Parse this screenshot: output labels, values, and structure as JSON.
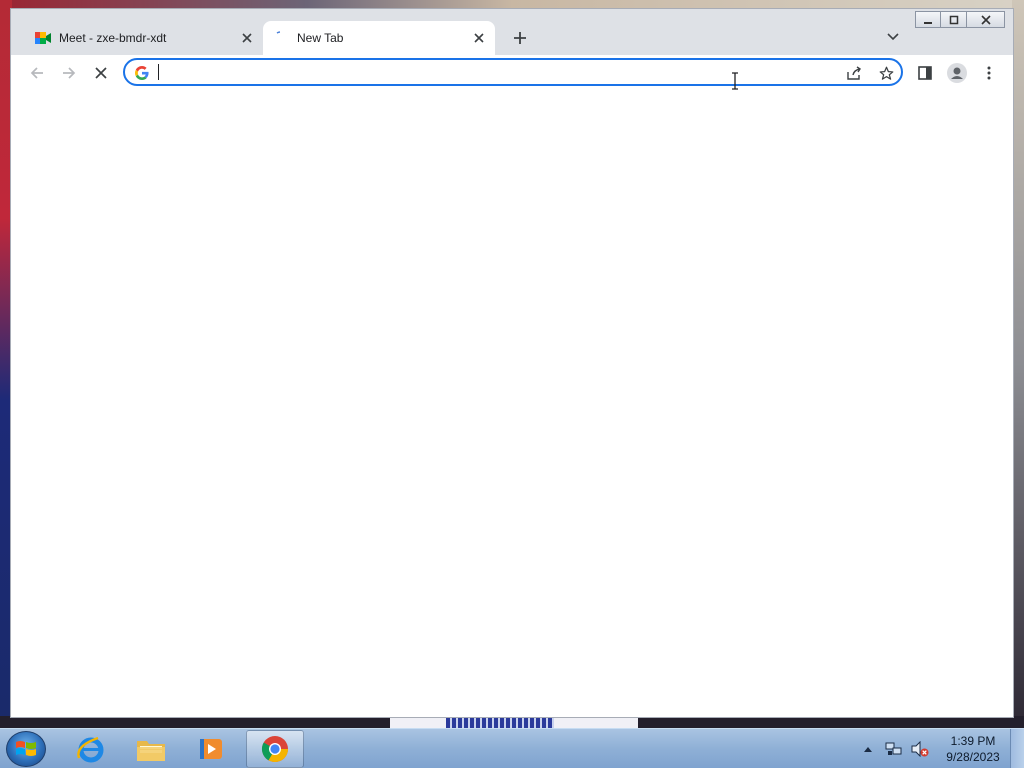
{
  "browser": {
    "window_controls": {
      "minimize_icon": "minimize-icon",
      "restore_icon": "restore-icon",
      "close_icon": "close-icon"
    },
    "tabs": [
      {
        "title": "Meet - zxe-bmdr-xdt",
        "favicon": "google-meet-icon",
        "active": false
      },
      {
        "title": "New Tab",
        "favicon": "loading-spinner-icon",
        "active": true
      }
    ],
    "toolbar": {
      "back_icon": "arrow-back-icon",
      "forward_icon": "arrow-forward-icon",
      "stop_icon": "stop-loading-icon",
      "omnibox": {
        "value": "",
        "placeholder": "",
        "engine_icon": "google-g-icon"
      },
      "share_icon": "share-icon",
      "bookmark_icon": "star-icon",
      "side_panel_icon": "side-panel-icon",
      "profile_icon": "profile-icon",
      "menu_icon": "kebab-menu-icon"
    },
    "accent_color": "#1a73e8"
  },
  "taskbar": {
    "pinned": [
      "internet-explorer-icon",
      "file-explorer-icon",
      "media-player-icon",
      "chrome-icon"
    ],
    "clock": {
      "time": "1:39 PM",
      "date": "9/28/2023"
    }
  }
}
